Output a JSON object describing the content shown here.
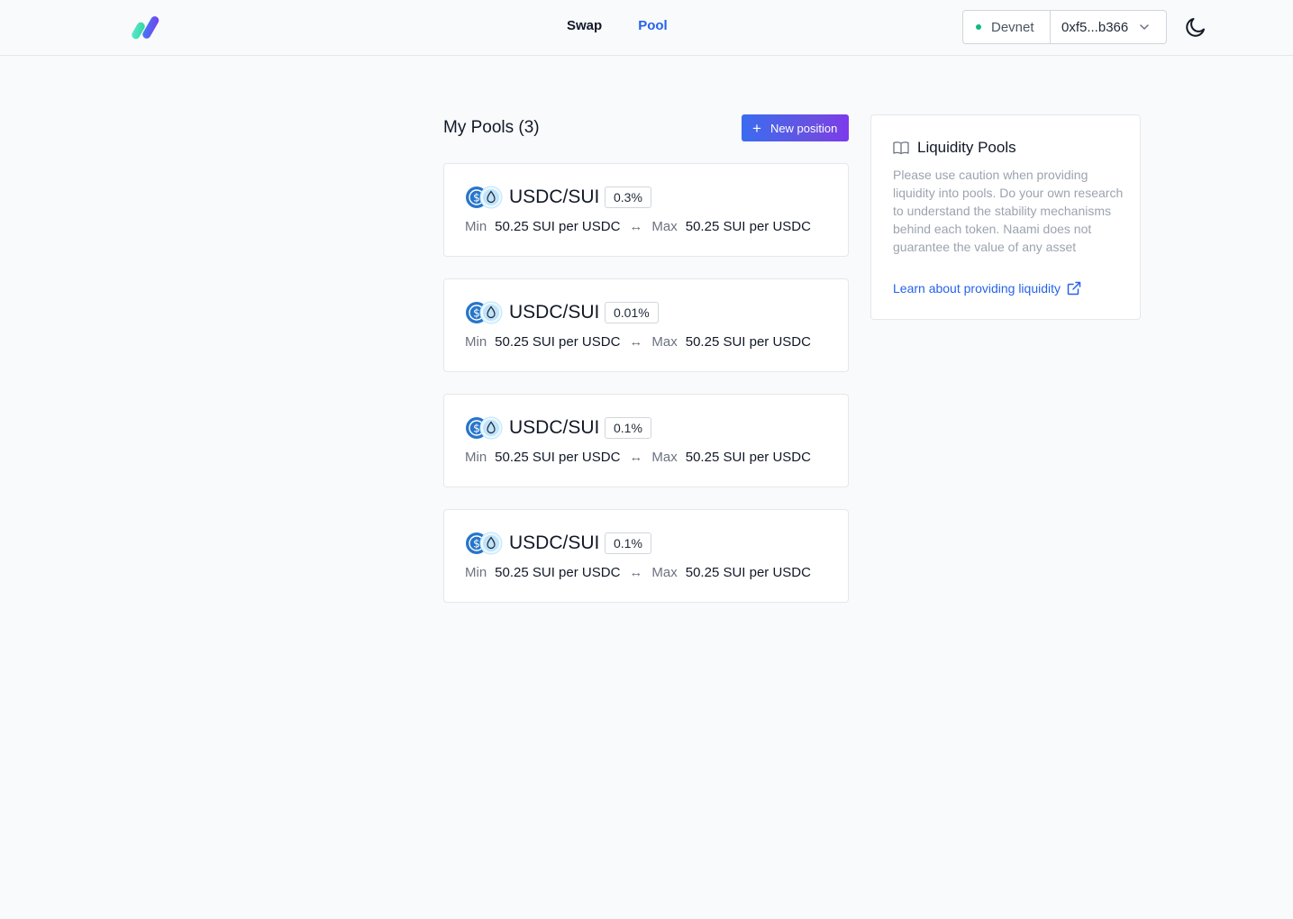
{
  "nav": {
    "swap": "Swap",
    "pool": "Pool"
  },
  "wallet": {
    "network": "Devnet",
    "address": "0xf5...b366"
  },
  "pools": {
    "title": "My Pools (3)",
    "new_position": "New position",
    "items": [
      {
        "pair": "USDC/SUI",
        "fee": "0.3%",
        "min_label": "Min",
        "min_value": "50.25 SUI per USDC",
        "max_label": "Max",
        "max_value": "50.25 SUI per USDC"
      },
      {
        "pair": "USDC/SUI",
        "fee": "0.01%",
        "min_label": "Min",
        "min_value": "50.25 SUI per USDC",
        "max_label": "Max",
        "max_value": "50.25 SUI per USDC"
      },
      {
        "pair": "USDC/SUI",
        "fee": "0.1%",
        "min_label": "Min",
        "min_value": "50.25 SUI per USDC",
        "max_label": "Max",
        "max_value": "50.25 SUI per USDC"
      },
      {
        "pair": "USDC/SUI",
        "fee": "0.1%",
        "min_label": "Min",
        "min_value": "50.25 SUI per USDC",
        "max_label": "Max",
        "max_value": "50.25 SUI per USDC"
      }
    ]
  },
  "info": {
    "title": "Liquidity Pools",
    "body": "Please use caution when providing liquidity into pools. Do your own research to understand the stability mechanisms behind each token. Naami does not guarantee the value of any asset",
    "link": "Learn about providing liquidity"
  },
  "colors": {
    "accent": "#2563eb",
    "status_online": "#10b981",
    "button_gradient_start": "#3b6cf0",
    "button_gradient_end": "#7c3aed"
  },
  "icons": [
    "logo-icon",
    "chevron-down-icon",
    "moon-icon",
    "plus-icon",
    "usdc-icon",
    "sui-icon",
    "swap-arrows-icon",
    "book-icon",
    "external-link-icon"
  ]
}
